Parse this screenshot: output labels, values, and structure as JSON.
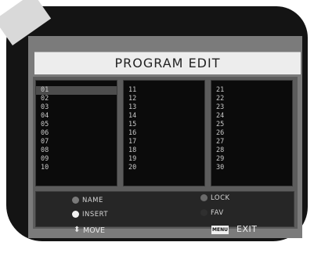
{
  "title": "PROGRAM EDIT",
  "columns": [
    [
      "01",
      "02",
      "03",
      "04",
      "05",
      "06",
      "07",
      "08",
      "09",
      "10"
    ],
    [
      "11",
      "12",
      "13",
      "14",
      "15",
      "16",
      "17",
      "18",
      "19",
      "20"
    ],
    [
      "21",
      "22",
      "23",
      "24",
      "25",
      "26",
      "27",
      "28",
      "29",
      "30"
    ]
  ],
  "selected": "01",
  "legend": {
    "name": "NAME",
    "insert": "INSERT",
    "lock": "LOCK",
    "fav": "FAV"
  },
  "footer": {
    "move": "MOVE",
    "menu_key": "MENU",
    "exit": "EXIT"
  },
  "icons": {
    "move": "up-down-arrow-icon"
  }
}
